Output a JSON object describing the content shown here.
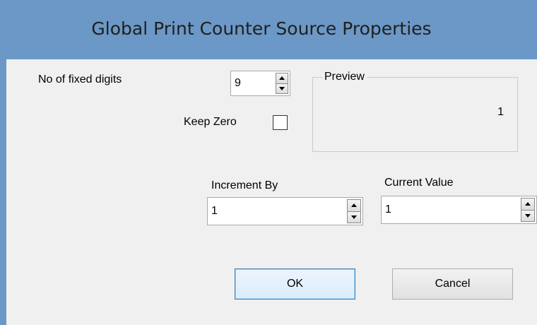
{
  "window": {
    "title": "Global Print Counter Source Properties",
    "colors": {
      "titlebar": "#6b98c6",
      "client": "#f0f0f0",
      "ok_border": "#3c7fb1"
    }
  },
  "fixed_digits": {
    "label": "No of fixed digits",
    "value": "9"
  },
  "keep_zero": {
    "label": "Keep Zero",
    "checked": false
  },
  "preview": {
    "legend": "Preview",
    "value": "1"
  },
  "increment_by": {
    "label": "Increment By",
    "value": "1"
  },
  "current_value": {
    "label": "Current Value",
    "value": "1"
  },
  "buttons": {
    "ok": "OK",
    "cancel": "Cancel"
  },
  "icons": {
    "spin_up": "spin-up-icon",
    "spin_down": "spin-down-icon"
  }
}
